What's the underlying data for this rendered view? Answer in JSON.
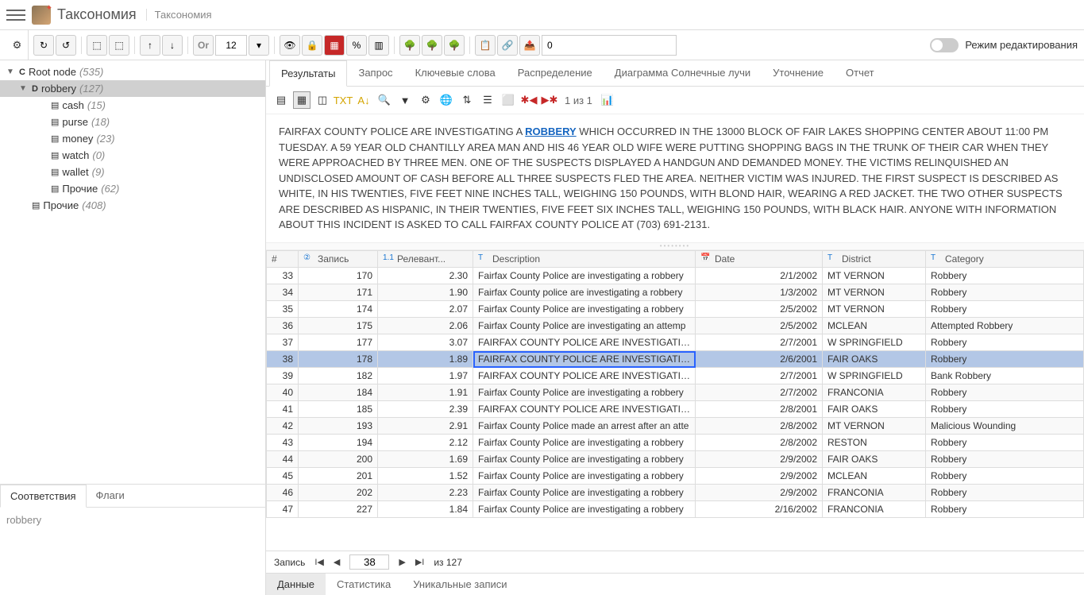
{
  "header": {
    "title": "Таксономия",
    "subtitle": "Таксономия"
  },
  "toolbar": {
    "font_size": "12",
    "or_label": "Or",
    "spinner_value": "0",
    "edit_mode_label": "Режим редактирования"
  },
  "tree": {
    "root": {
      "letter": "C",
      "label": "Root node",
      "count": "(535)"
    },
    "items": [
      {
        "letter": "D",
        "label": "robbery",
        "count": "(127)",
        "selected": true,
        "indent": 1,
        "expandable": true
      },
      {
        "label": "cash",
        "count": "(15)",
        "indent": 2
      },
      {
        "label": "purse",
        "count": "(18)",
        "indent": 2
      },
      {
        "label": "money",
        "count": "(23)",
        "indent": 2
      },
      {
        "label": "watch",
        "count": "(0)",
        "indent": 2
      },
      {
        "label": "wallet",
        "count": "(9)",
        "indent": 2
      },
      {
        "label": "Прочие",
        "count": "(62)",
        "indent": 2
      },
      {
        "label": "Прочие",
        "count": "(408)",
        "indent": 1
      }
    ]
  },
  "lower_tabs": {
    "tab1": "Соответствия",
    "tab2": "Флаги",
    "content": "robbery"
  },
  "main_tabs": [
    "Результаты",
    "Запрос",
    "Ключевые слова",
    "Распределение",
    "Диаграмма Солнечные лучи",
    "Уточнение",
    "Отчет"
  ],
  "results_toolbar": {
    "pager_text": "1 из 1"
  },
  "detail": {
    "pre": "FAIRFAX COUNTY POLICE ARE INVESTIGATING A ",
    "highlight": "ROBBERY",
    "post": " WHICH OCCURRED IN THE 13000 BLOCK OF FAIR LAKES SHOPPING CENTER ABOUT 11:00 PM TUESDAY. A 59 YEAR OLD CHANTILLY AREA MAN AND HIS 46 YEAR OLD WIFE WERE PUTTING SHOPPING BAGS IN THE TRUNK OF THEIR CAR WHEN THEY WERE APPROACHED BY THREE MEN. ONE OF THE SUSPECTS DISPLAYED A HANDGUN AND DEMANDED MONEY. THE VICTIMS RELINQUISHED AN UNDISCLOSED AMOUNT OF CASH BEFORE ALL THREE SUSPECTS FLED THE AREA. NEITHER VICTIM WAS INJURED. THE FIRST SUSPECT IS DESCRIBED AS WHITE, IN HIS TWENTIES, FIVE FEET NINE INCHES TALL, WEIGHING 150 POUNDS, WITH BLOND HAIR, WEARING A RED JACKET. THE TWO OTHER SUSPECTS ARE DESCRIBED AS HISPANIC, IN THEIR TWENTIES, FIVE FEET SIX INCHES TALL, WEIGHING 150 POUNDS, WITH BLACK HAIR. ANYONE WITH INFORMATION ABOUT THIS INCIDENT IS ASKED TO CALL FAIRFAX COUNTY POLICE AT (703) 691-2131."
  },
  "grid": {
    "columns": {
      "num": "#",
      "record": "Запись",
      "relevance": "Релевант...",
      "description": "Description",
      "date": "Date",
      "district": "District",
      "category": "Category"
    },
    "rows": [
      {
        "n": "33",
        "rec": "170",
        "rel": "2.30",
        "desc": "Fairfax County Police are investigating a robbery",
        "date": "2/1/2002",
        "district": "MT VERNON",
        "cat": "Robbery"
      },
      {
        "n": "34",
        "rec": "171",
        "rel": "1.90",
        "desc": "Fairfax County police are investigating a robbery",
        "date": "1/3/2002",
        "district": "MT VERNON",
        "cat": "Robbery"
      },
      {
        "n": "35",
        "rec": "174",
        "rel": "2.07",
        "desc": "Fairfax County Police are investigating a robbery",
        "date": "2/5/2002",
        "district": "MT VERNON",
        "cat": "Robbery"
      },
      {
        "n": "36",
        "rec": "175",
        "rel": "2.06",
        "desc": "Fairfax County Police are investigating an attemp",
        "date": "2/5/2002",
        "district": "MCLEAN",
        "cat": "Attempted Robbery"
      },
      {
        "n": "37",
        "rec": "177",
        "rel": "3.07",
        "desc": "FAIRFAX COUNTY POLICE ARE INVESTIGATING TH",
        "date": "2/7/2001",
        "district": "W SPRINGFIELD",
        "cat": "Robbery"
      },
      {
        "n": "38",
        "rec": "178",
        "rel": "1.89",
        "desc": "FAIRFAX COUNTY POLICE ARE INVESTIGATING A R",
        "date": "2/6/2001",
        "district": "FAIR OAKS",
        "cat": "Robbery",
        "selected": true
      },
      {
        "n": "39",
        "rec": "182",
        "rel": "1.97",
        "desc": "FAIRFAX COUNTY POLICE ARE INVESTIGATING A B",
        "date": "2/7/2001",
        "district": "W SPRINGFIELD",
        "cat": "Bank Robbery"
      },
      {
        "n": "40",
        "rec": "184",
        "rel": "1.91",
        "desc": "Fairfax County Police are investigating a robbery",
        "date": "2/7/2002",
        "district": "FRANCONIA",
        "cat": "Robbery"
      },
      {
        "n": "41",
        "rec": "185",
        "rel": "2.39",
        "desc": "FAIRFAX COUNTY POLICE ARE INVESTIGATING A H",
        "date": "2/8/2001",
        "district": "FAIR OAKS",
        "cat": "Robbery"
      },
      {
        "n": "42",
        "rec": "193",
        "rel": "2.91",
        "desc": "Fairfax County Police made an arrest after an atte",
        "date": "2/8/2002",
        "district": "MT VERNON",
        "cat": "Malicious Wounding"
      },
      {
        "n": "43",
        "rec": "194",
        "rel": "2.12",
        "desc": "Fairfax County Police are investigating a robbery",
        "date": "2/8/2002",
        "district": "RESTON",
        "cat": "Robbery"
      },
      {
        "n": "44",
        "rec": "200",
        "rel": "1.69",
        "desc": "Fairfax County Police are investigating a robbery",
        "date": "2/9/2002",
        "district": "FAIR OAKS",
        "cat": "Robbery"
      },
      {
        "n": "45",
        "rec": "201",
        "rel": "1.52",
        "desc": "Fairfax County Police are investigating a robbery",
        "date": "2/9/2002",
        "district": "MCLEAN",
        "cat": "Robbery"
      },
      {
        "n": "46",
        "rec": "202",
        "rel": "2.23",
        "desc": "Fairfax County Police are investigating a robbery",
        "date": "2/9/2002",
        "district": "FRANCONIA",
        "cat": "Robbery"
      },
      {
        "n": "47",
        "rec": "227",
        "rel": "1.84",
        "desc": "Fairfax County Police are investigating a robbery",
        "date": "2/16/2002",
        "district": "FRANCONIA",
        "cat": "Robbery"
      }
    ]
  },
  "pager": {
    "label": "Запись",
    "value": "38",
    "of_label": "из 127"
  },
  "bottom_tabs": [
    "Данные",
    "Статистика",
    "Уникальные записи"
  ]
}
